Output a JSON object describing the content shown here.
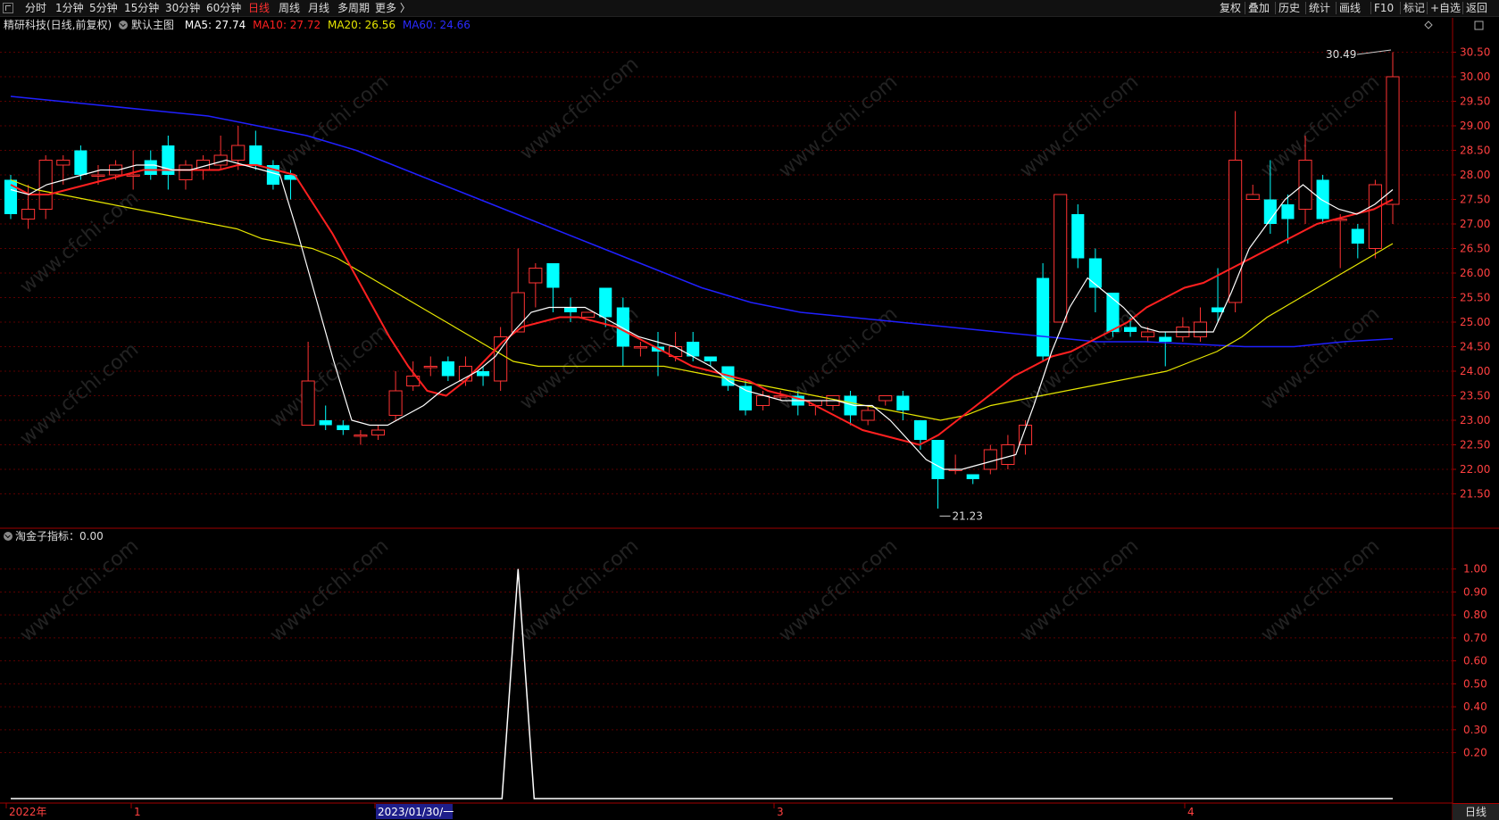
{
  "toolbar_left": [
    "分时",
    "1分钟",
    "5分钟",
    "15分钟",
    "30分钟",
    "60分钟",
    "日线",
    "周线",
    "月线",
    "多周期",
    "更多 〉"
  ],
  "active_period": "日线",
  "toolbar_right": [
    "复权",
    "叠加",
    "历史",
    "统计",
    "画线",
    "F10",
    "标记",
    "+自选",
    "返回"
  ],
  "main_legend": {
    "stock": "精研科技(日线,前复权)",
    "indicator": "默认主图",
    "ma5": "MA5: 27.74",
    "ma10": "MA10: 27.72",
    "ma20": "MA20: 26.56",
    "ma60": "MA60: 24.66"
  },
  "sub_legend": "淘金子指标：0.00",
  "high_label": "30.49",
  "low_label": "21.23",
  "x_axis_labels": [
    "2022年",
    "1",
    "2023/01/30/一",
    "3",
    "4"
  ],
  "bottom_tab": "日线",
  "colors": {
    "up": "#ff3333",
    "down": "#00ffff",
    "ma5": "#ffffff",
    "ma10": "#ff2020",
    "ma20": "#e6e600",
    "ma60": "#2020ff",
    "axis": "#a00000",
    "grid": "#5a0000"
  },
  "chart_data": [
    {
      "type": "candlestick",
      "ylim": [
        20.8,
        30.8
      ],
      "y_ticks": [
        21.5,
        22.0,
        22.5,
        23.0,
        23.5,
        24.0,
        24.5,
        25.0,
        25.5,
        26.0,
        26.5,
        27.0,
        27.5,
        28.0,
        28.5,
        29.0,
        29.5,
        30.0,
        30.5
      ],
      "candles": [
        [
          27.9,
          27.2,
          28.0,
          27.1
        ],
        [
          27.1,
          27.3,
          27.8,
          26.9
        ],
        [
          27.3,
          28.3,
          28.4,
          27.1
        ],
        [
          28.2,
          28.3,
          28.4,
          27.8
        ],
        [
          28.5,
          28.0,
          28.6,
          27.9
        ],
        [
          28.0,
          28.0,
          28.2,
          27.8
        ],
        [
          28.0,
          28.2,
          28.3,
          27.9
        ],
        [
          28.0,
          28.0,
          28.5,
          27.7
        ],
        [
          28.3,
          28.0,
          28.5,
          27.9
        ],
        [
          28.6,
          28.0,
          28.8,
          27.7
        ],
        [
          27.9,
          28.2,
          28.3,
          27.7
        ],
        [
          28.1,
          28.3,
          28.4,
          27.9
        ],
        [
          28.2,
          28.4,
          28.8,
          28.1
        ],
        [
          28.3,
          28.6,
          29.0,
          28.1
        ],
        [
          28.6,
          28.2,
          28.9,
          28.1
        ],
        [
          28.2,
          27.8,
          28.3,
          27.7
        ],
        [
          28.0,
          27.9,
          28.1,
          27.5
        ],
        [
          22.9,
          23.8,
          24.6,
          22.9
        ],
        [
          23.0,
          22.9,
          23.3,
          22.8
        ],
        [
          22.9,
          22.8,
          23.0,
          22.7
        ],
        [
          22.7,
          22.7,
          22.8,
          22.5
        ],
        [
          22.7,
          22.8,
          22.9,
          22.6
        ],
        [
          23.1,
          23.6,
          24.0,
          23.0
        ],
        [
          23.7,
          23.9,
          24.2,
          23.6
        ],
        [
          24.1,
          24.1,
          24.3,
          23.9
        ],
        [
          24.2,
          23.9,
          24.3,
          23.8
        ],
        [
          23.8,
          24.1,
          24.3,
          23.7
        ],
        [
          24.0,
          23.9,
          24.1,
          23.7
        ],
        [
          23.8,
          24.7,
          24.9,
          23.6
        ],
        [
          24.8,
          25.6,
          26.5,
          24.8
        ],
        [
          25.8,
          26.1,
          26.2,
          25.3
        ],
        [
          26.2,
          25.7,
          26.2,
          25.2
        ],
        [
          25.3,
          25.2,
          25.5,
          25.0
        ],
        [
          25.1,
          25.2,
          25.2,
          25.1
        ],
        [
          25.7,
          25.1,
          25.7,
          24.9
        ],
        [
          25.3,
          24.5,
          25.5,
          24.1
        ],
        [
          24.5,
          24.5,
          24.6,
          24.3
        ],
        [
          24.5,
          24.4,
          24.8,
          23.9
        ],
        [
          24.3,
          24.5,
          24.8,
          24.2
        ],
        [
          24.6,
          24.3,
          24.8,
          24.2
        ],
        [
          24.3,
          24.2,
          24.3,
          24.1
        ],
        [
          24.1,
          23.7,
          24.1,
          23.6
        ],
        [
          23.7,
          23.2,
          23.8,
          23.1
        ],
        [
          23.3,
          23.5,
          23.6,
          23.2
        ],
        [
          23.5,
          23.5,
          23.6,
          23.4
        ],
        [
          23.5,
          23.3,
          23.6,
          23.1
        ],
        [
          23.3,
          23.4,
          23.4,
          23.1
        ],
        [
          23.3,
          23.5,
          23.5,
          23.2
        ],
        [
          23.5,
          23.1,
          23.6,
          22.9
        ],
        [
          23.0,
          23.2,
          23.3,
          22.9
        ],
        [
          23.4,
          23.5,
          23.5,
          23.3
        ],
        [
          23.5,
          23.2,
          23.6,
          23.0
        ],
        [
          23.0,
          22.6,
          23.0,
          22.4
        ],
        [
          22.6,
          21.8,
          22.6,
          21.2
        ],
        [
          22.0,
          22.0,
          22.3,
          21.9
        ],
        [
          21.9,
          21.8,
          21.9,
          21.7
        ],
        [
          22.0,
          22.4,
          22.5,
          21.9
        ],
        [
          22.1,
          22.5,
          22.7,
          22.0
        ],
        [
          22.5,
          22.9,
          23.0,
          22.3
        ],
        [
          25.9,
          24.3,
          26.2,
          24.2
        ],
        [
          25.0,
          27.6,
          27.6,
          25.0
        ],
        [
          27.2,
          26.3,
          27.4,
          26.1
        ],
        [
          26.3,
          25.7,
          26.5,
          25.2
        ],
        [
          25.6,
          24.8,
          25.6,
          24.7
        ],
        [
          24.9,
          24.8,
          25.1,
          24.7
        ],
        [
          24.7,
          24.8,
          24.9,
          24.6
        ],
        [
          24.7,
          24.6,
          24.8,
          24.1
        ],
        [
          24.7,
          24.9,
          25.1,
          24.6
        ],
        [
          24.7,
          25.0,
          25.3,
          24.6
        ],
        [
          25.3,
          25.2,
          26.1,
          25.0
        ],
        [
          25.4,
          28.3,
          29.3,
          25.2
        ],
        [
          27.5,
          27.6,
          27.8,
          27.5
        ],
        [
          27.5,
          27.0,
          28.3,
          26.8
        ],
        [
          27.4,
          27.1,
          27.6,
          26.6
        ],
        [
          27.3,
          28.3,
          28.8,
          27.0
        ],
        [
          27.9,
          27.1,
          28.0,
          27.0
        ],
        [
          27.1,
          27.1,
          27.2,
          26.1
        ],
        [
          26.9,
          26.6,
          27.0,
          26.3
        ],
        [
          26.5,
          27.8,
          27.9,
          26.3
        ],
        [
          27.4,
          30.0,
          30.5,
          27.0
        ]
      ],
      "ma5": [
        27.7,
        27.6,
        27.8,
        27.9,
        28.0,
        28.1,
        28.1,
        28.2,
        28.2,
        28.1,
        28.1,
        28.2,
        28.3,
        28.2,
        28.1,
        28.0,
        26.8,
        25.5,
        24.2,
        23.0,
        22.9,
        22.9,
        23.1,
        23.3,
        23.6,
        23.8,
        24.0,
        24.3,
        24.8,
        25.2,
        25.3,
        25.3,
        25.3,
        25.1,
        24.9,
        24.7,
        24.6,
        24.5,
        24.3,
        24.1,
        23.8,
        23.6,
        23.5,
        23.4,
        23.4,
        23.4,
        23.4,
        23.3,
        23.3,
        23.0,
        22.6,
        22.2,
        22.0,
        22.0,
        22.1,
        22.2,
        22.3,
        23.3,
        24.4,
        25.3,
        25.9,
        25.6,
        25.3,
        24.9,
        24.8,
        24.8,
        24.8,
        24.8,
        25.6,
        26.5,
        27.0,
        27.5,
        27.8,
        27.5,
        27.3,
        27.2,
        27.4,
        27.7
      ],
      "ma10": [
        27.8,
        27.6,
        27.6,
        27.7,
        27.8,
        27.9,
        28.0,
        28.1,
        28.1,
        28.1,
        28.1,
        28.1,
        28.2,
        28.2,
        28.1,
        28.0,
        27.4,
        26.8,
        26.1,
        25.4,
        24.7,
        24.1,
        23.6,
        23.5,
        23.8,
        24.2,
        24.6,
        24.9,
        25.0,
        25.1,
        25.1,
        25.0,
        24.9,
        24.7,
        24.5,
        24.3,
        24.1,
        24.0,
        23.9,
        23.8,
        23.6,
        23.5,
        23.4,
        23.2,
        23.0,
        22.8,
        22.7,
        22.6,
        22.5,
        22.7,
        23.0,
        23.3,
        23.6,
        23.9,
        24.1,
        24.3,
        24.4,
        24.6,
        24.8,
        25.0,
        25.3,
        25.5,
        25.7,
        25.8,
        26.0,
        26.2,
        26.4,
        26.6,
        26.8,
        27.0,
        27.1,
        27.2,
        27.3,
        27.5
      ],
      "ma20": [
        27.9,
        27.7,
        27.6,
        27.5,
        27.4,
        27.3,
        27.2,
        27.1,
        27.0,
        26.9,
        26.7,
        26.6,
        26.5,
        26.3,
        26.0,
        25.7,
        25.4,
        25.1,
        24.8,
        24.5,
        24.2,
        24.1,
        24.1,
        24.1,
        24.1,
        24.1,
        24.1,
        24.0,
        23.9,
        23.8,
        23.7,
        23.6,
        23.5,
        23.4,
        23.3,
        23.2,
        23.1,
        23.0,
        23.1,
        23.3,
        23.4,
        23.5,
        23.6,
        23.7,
        23.8,
        23.9,
        24.0,
        24.2,
        24.4,
        24.7,
        25.1,
        25.4,
        25.7,
        26.0,
        26.3,
        26.6
      ],
      "ma60": [
        29.6,
        29.5,
        29.4,
        29.3,
        29.2,
        29.0,
        28.8,
        28.5,
        28.1,
        27.7,
        27.3,
        26.9,
        26.5,
        26.1,
        25.7,
        25.4,
        25.2,
        25.1,
        25.0,
        24.9,
        24.8,
        24.7,
        24.6,
        24.6,
        24.55,
        24.5,
        24.5,
        24.6,
        24.66
      ]
    },
    {
      "type": "line",
      "name": "淘金子指标",
      "ylim": [
        0.0,
        1.1
      ],
      "y_ticks": [
        0.2,
        0.3,
        0.4,
        0.5,
        0.6,
        0.7,
        0.8,
        0.9,
        1.0
      ],
      "spike_index": 29,
      "spike_value": 1.0
    }
  ],
  "watermark": "www.cfchi.com"
}
